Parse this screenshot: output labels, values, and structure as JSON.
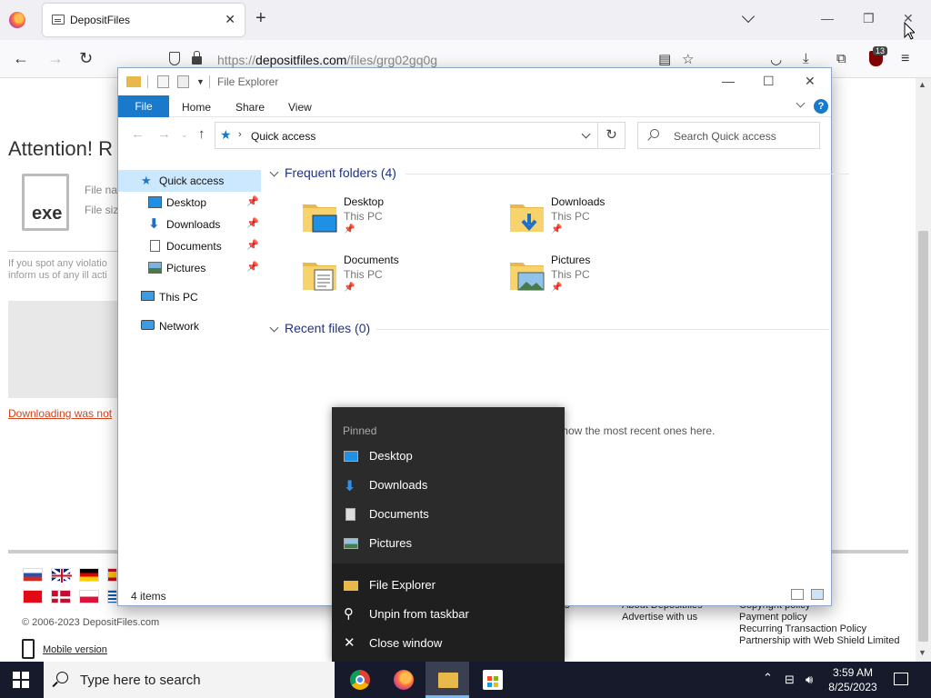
{
  "browser": {
    "tab_title": "DepositFiles",
    "url_prefix": "https://",
    "url_domain": "depositfiles.com",
    "url_path": "/files/grg02gq0g",
    "extension_badge": "13"
  },
  "webpage": {
    "heading": "Attention! R",
    "file_name_label": "File nar",
    "file_size_label": "File size",
    "file_icon_text": "exe",
    "notice_line1": "If you spot any violatio",
    "notice_line2": "inform us of any ill acti",
    "download_link": "Downloading was not",
    "copyright": "© 2006-2023 DepositFiles.com",
    "mobile_version": "Mobile version",
    "footer_col1": [
      "About Depositfiles",
      "Advertise with us"
    ],
    "footer_col2": [
      "Copyright policy",
      "Payment policy",
      "Recurring Transaction Policy",
      "Partnership with Web Shield Limited"
    ],
    "footer_fragment": "s"
  },
  "explorer": {
    "title": "File Explorer",
    "ribbon_tabs": [
      "File",
      "Home",
      "Share",
      "View"
    ],
    "help_label": "?",
    "address": "Quick access",
    "search_placeholder": "Search Quick access",
    "nav": [
      {
        "label": "Quick access",
        "icon": "star-icon",
        "pinned": false
      },
      {
        "label": "Desktop",
        "icon": "desktop-icon",
        "pinned": true
      },
      {
        "label": "Downloads",
        "icon": "download-icon",
        "pinned": true
      },
      {
        "label": "Documents",
        "icon": "documents-icon",
        "pinned": true
      },
      {
        "label": "Pictures",
        "icon": "pictures-icon",
        "pinned": true
      },
      {
        "label": "This PC",
        "icon": "computer-icon",
        "pinned": false
      },
      {
        "label": "Network",
        "icon": "network-icon",
        "pinned": false
      }
    ],
    "frequent_header": "Frequent folders (4)",
    "frequent_folders": [
      {
        "name": "Desktop",
        "location": "This PC"
      },
      {
        "name": "Downloads",
        "location": "This PC"
      },
      {
        "name": "Documents",
        "location": "This PC"
      },
      {
        "name": "Pictures",
        "location": "This PC"
      }
    ],
    "recent_header": "Recent files (0)",
    "recent_empty": "After you've opened some files, we'll show the most recent ones here.",
    "status_count": "4 items"
  },
  "jumplist": {
    "pinned_header": "Pinned",
    "pinned_items": [
      "Desktop",
      "Downloads",
      "Documents",
      "Pictures"
    ],
    "app_item": "File Explorer",
    "unpin": "Unpin from taskbar",
    "close": "Close window"
  },
  "taskbar": {
    "search_placeholder": "Type here to search",
    "time": "3:59 AM",
    "date": "8/25/2023"
  },
  "colors": {
    "accent": "#1979ca",
    "selection": "#cce8ff",
    "folder": "#e8b84a",
    "taskbar": "#161a2a",
    "jumplist": "#2b2b2b"
  }
}
